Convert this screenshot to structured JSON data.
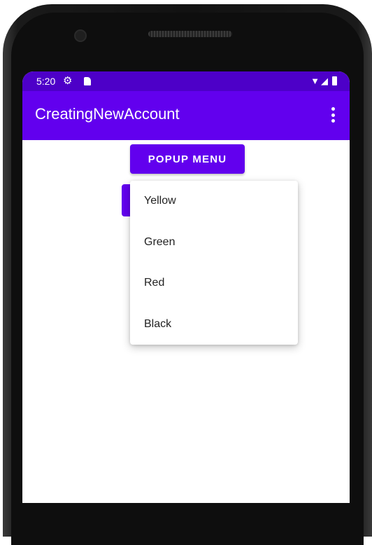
{
  "status_bar": {
    "time": "5:20",
    "gear_icon": "settings-gear",
    "signal_icons": "▼◢"
  },
  "app_bar": {
    "title": "CreatingNewAccount",
    "overflow_icon": "more-vert"
  },
  "popup_button": {
    "label": "POPUP MENU"
  },
  "popup_menu": {
    "items": [
      {
        "label": "Yellow"
      },
      {
        "label": "Green"
      },
      {
        "label": "Red"
      },
      {
        "label": "Black"
      }
    ]
  },
  "colors": {
    "primary": "#6200ee",
    "primary_dark": "#4d00c8"
  }
}
